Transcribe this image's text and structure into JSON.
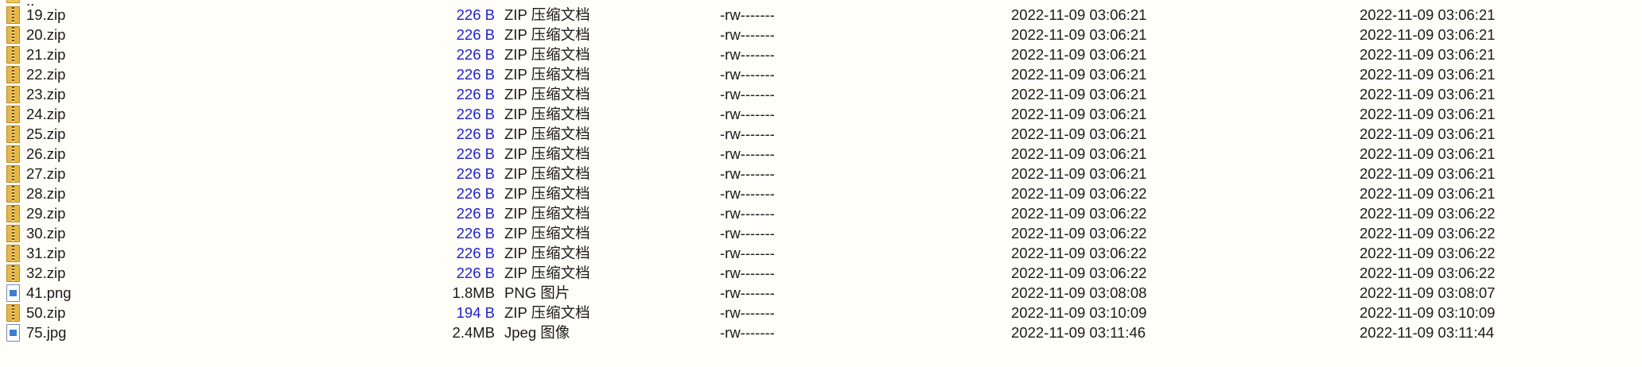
{
  "parent_dir": {
    "label": ".."
  },
  "files": [
    {
      "name": "19.zip",
      "size": "226 B",
      "type": "ZIP 压缩文档",
      "perms": "-rw-------",
      "modified": "2022-11-09 03:06:21",
      "accessed": "2022-11-09 03:06:21",
      "icon": "zip-icon"
    },
    {
      "name": "20.zip",
      "size": "226 B",
      "type": "ZIP 压缩文档",
      "perms": "-rw-------",
      "modified": "2022-11-09 03:06:21",
      "accessed": "2022-11-09 03:06:21",
      "icon": "zip-icon"
    },
    {
      "name": "21.zip",
      "size": "226 B",
      "type": "ZIP 压缩文档",
      "perms": "-rw-------",
      "modified": "2022-11-09 03:06:21",
      "accessed": "2022-11-09 03:06:21",
      "icon": "zip-icon"
    },
    {
      "name": "22.zip",
      "size": "226 B",
      "type": "ZIP 压缩文档",
      "perms": "-rw-------",
      "modified": "2022-11-09 03:06:21",
      "accessed": "2022-11-09 03:06:21",
      "icon": "zip-icon"
    },
    {
      "name": "23.zip",
      "size": "226 B",
      "type": "ZIP 压缩文档",
      "perms": "-rw-------",
      "modified": "2022-11-09 03:06:21",
      "accessed": "2022-11-09 03:06:21",
      "icon": "zip-icon"
    },
    {
      "name": "24.zip",
      "size": "226 B",
      "type": "ZIP 压缩文档",
      "perms": "-rw-------",
      "modified": "2022-11-09 03:06:21",
      "accessed": "2022-11-09 03:06:21",
      "icon": "zip-icon"
    },
    {
      "name": "25.zip",
      "size": "226 B",
      "type": "ZIP 压缩文档",
      "perms": "-rw-------",
      "modified": "2022-11-09 03:06:21",
      "accessed": "2022-11-09 03:06:21",
      "icon": "zip-icon"
    },
    {
      "name": "26.zip",
      "size": "226 B",
      "type": "ZIP 压缩文档",
      "perms": "-rw-------",
      "modified": "2022-11-09 03:06:21",
      "accessed": "2022-11-09 03:06:21",
      "icon": "zip-icon"
    },
    {
      "name": "27.zip",
      "size": "226 B",
      "type": "ZIP 压缩文档",
      "perms": "-rw-------",
      "modified": "2022-11-09 03:06:21",
      "accessed": "2022-11-09 03:06:21",
      "icon": "zip-icon"
    },
    {
      "name": "28.zip",
      "size": "226 B",
      "type": "ZIP 压缩文档",
      "perms": "-rw-------",
      "modified": "2022-11-09 03:06:22",
      "accessed": "2022-11-09 03:06:21",
      "icon": "zip-icon"
    },
    {
      "name": "29.zip",
      "size": "226 B",
      "type": "ZIP 压缩文档",
      "perms": "-rw-------",
      "modified": "2022-11-09 03:06:22",
      "accessed": "2022-11-09 03:06:22",
      "icon": "zip-icon"
    },
    {
      "name": "30.zip",
      "size": "226 B",
      "type": "ZIP 压缩文档",
      "perms": "-rw-------",
      "modified": "2022-11-09 03:06:22",
      "accessed": "2022-11-09 03:06:22",
      "icon": "zip-icon"
    },
    {
      "name": "31.zip",
      "size": "226 B",
      "type": "ZIP 压缩文档",
      "perms": "-rw-------",
      "modified": "2022-11-09 03:06:22",
      "accessed": "2022-11-09 03:06:22",
      "icon": "zip-icon"
    },
    {
      "name": "32.zip",
      "size": "226 B",
      "type": "ZIP 压缩文档",
      "perms": "-rw-------",
      "modified": "2022-11-09 03:06:22",
      "accessed": "2022-11-09 03:06:22",
      "icon": "zip-icon"
    },
    {
      "name": "41.png",
      "size": "1.8MB",
      "type": "PNG 图片",
      "perms": "-rw-------",
      "modified": "2022-11-09 03:08:08",
      "accessed": "2022-11-09 03:08:07",
      "icon": "image-icon"
    },
    {
      "name": "50.zip",
      "size": "194 B",
      "type": "ZIP 压缩文档",
      "perms": "-rw-------",
      "modified": "2022-11-09 03:10:09",
      "accessed": "2022-11-09 03:10:09",
      "icon": "zip-icon"
    },
    {
      "name": "75.jpg",
      "size": "2.4MB",
      "type": "Jpeg 图像",
      "perms": "-rw-------",
      "modified": "2022-11-09 03:11:46",
      "accessed": "2022-11-09 03:11:44",
      "icon": "image-icon"
    }
  ],
  "colors": {
    "background": "#fffef8",
    "byte_size": "#1e1ed2",
    "text": "#1a1a1a"
  }
}
